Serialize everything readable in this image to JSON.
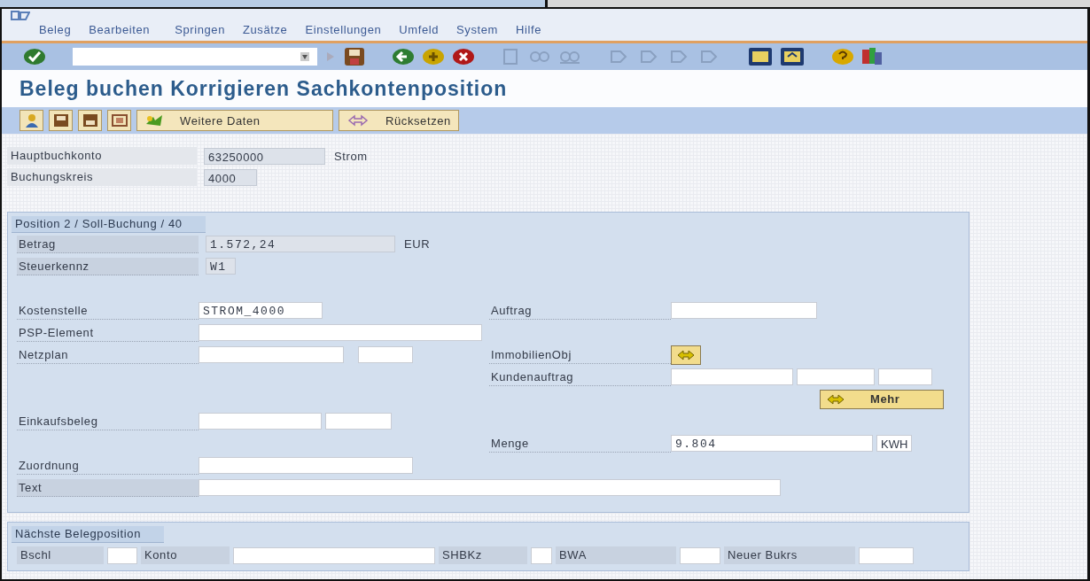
{
  "menu": [
    "Beleg",
    "Bearbeiten",
    "Springen",
    "Zusätze",
    "Einstellungen",
    "Umfeld",
    "System",
    "Hilfe"
  ],
  "title": "Beleg buchen Korrigieren Sachkontenposition",
  "app_toolbar": {
    "buttons": [
      "Weitere Daten",
      "Rücksetzen"
    ]
  },
  "header": [
    {
      "label": "Hauptbuchkonto",
      "value": "63250000",
      "text": "Strom"
    },
    {
      "label": "Buchungskreis",
      "value": "4000"
    }
  ],
  "position": {
    "title": "Position 2 / Soll-Buchung / 40",
    "betrag": {
      "label": "Betrag",
      "value": "1.572,24",
      "unit": "EUR"
    },
    "steuerkennz": {
      "label": "Steuerkennz",
      "value": "W1"
    },
    "kostenstelle": {
      "label": "Kostenstelle",
      "value": "STROM_4000"
    },
    "auftrag": {
      "label": "Auftrag"
    },
    "psp_element": {
      "label": "PSP-Element"
    },
    "netzplan": {
      "label": "Netzplan"
    },
    "immobilienobj": {
      "label": "ImmobilienObj"
    },
    "kundenauftrag": {
      "label": "Kundenauftrag"
    },
    "mehr_button": {
      "label": "Mehr"
    },
    "einkaufsbeleg": {
      "label": "Einkaufsbeleg"
    },
    "menge": {
      "label": "Menge",
      "value": "9.804",
      "unit": "KWH"
    },
    "zuordnung": {
      "label": "Zuordnung"
    },
    "text": {
      "label": "Text"
    }
  },
  "next_position": {
    "title": "Nächste Belegposition",
    "fields": [
      {
        "label": "Bschl"
      },
      {
        "label": "Konto"
      },
      {
        "label": "SHBKz"
      },
      {
        "label": "BWA"
      },
      {
        "label": "Neuer Bukrs"
      }
    ]
  }
}
